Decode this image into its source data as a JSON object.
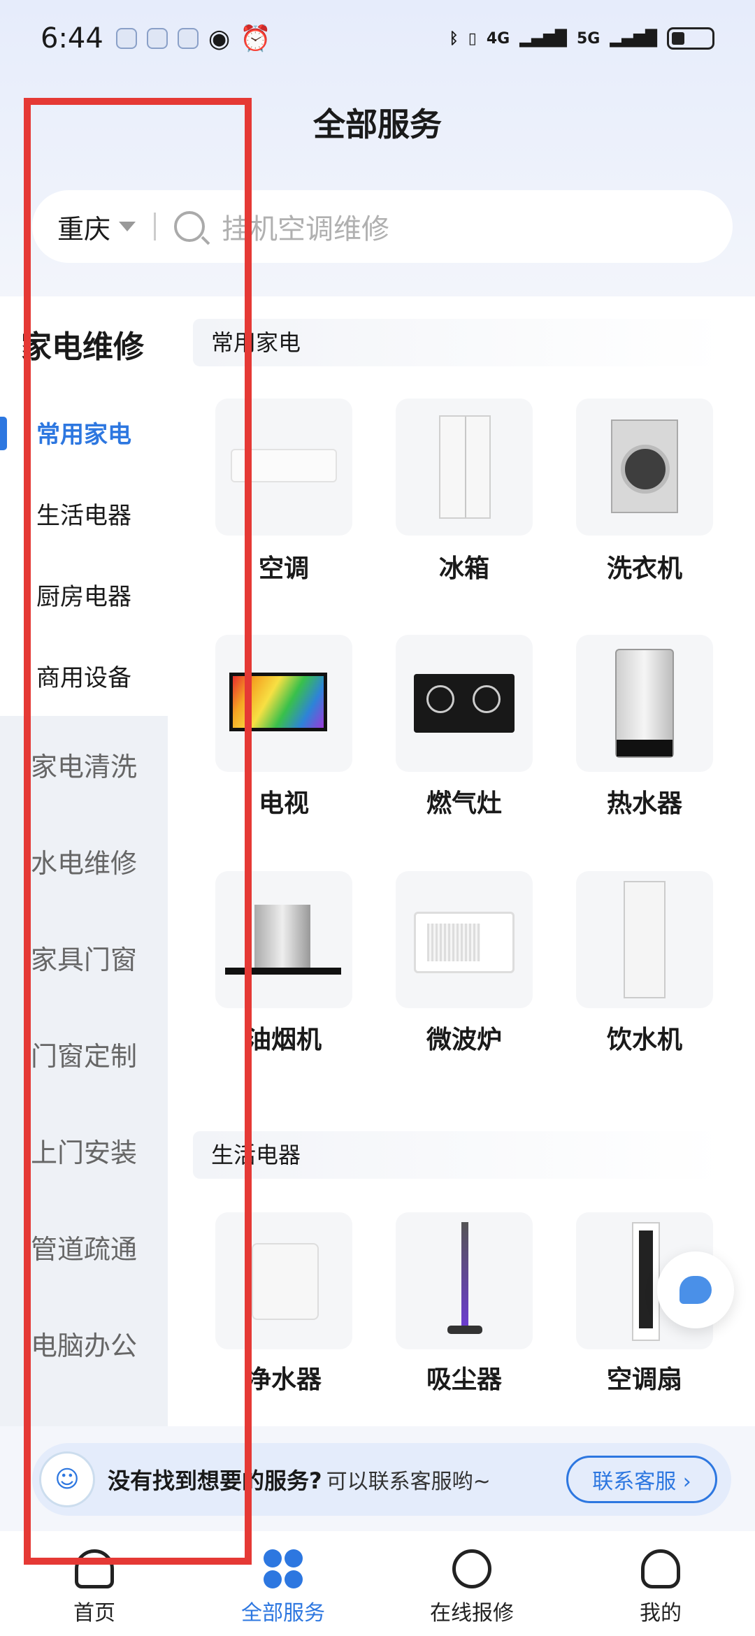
{
  "status": {
    "time": "6:44",
    "net1": "4G",
    "net2": "5G"
  },
  "title": "全部服务",
  "search": {
    "city": "重庆",
    "placeholder": "挂机空调维修"
  },
  "sidebar": {
    "group": "家电维修",
    "items": [
      "常用家电",
      "生活电器",
      "厨房电器",
      "商用设备"
    ],
    "active": "常用家电",
    "others": [
      "家电清洗",
      "水电维修",
      "家具门窗",
      "门窗定制",
      "上门安装",
      "管道疏通",
      "电脑办公"
    ]
  },
  "sections": [
    {
      "title": "常用家电",
      "items": [
        "空调",
        "冰箱",
        "洗衣机",
        "电视",
        "燃气灶",
        "热水器",
        "油烟机",
        "微波炉",
        "饮水机"
      ]
    },
    {
      "title": "生活电器",
      "items": [
        "净水器",
        "吸尘器",
        "空调扇"
      ]
    }
  ],
  "banner": {
    "text_bold": "没有找到想要的服务?",
    "text": "可以联系客服哟~",
    "button": "联系客服 ›"
  },
  "nav": [
    "首页",
    "全部服务",
    "在线报修",
    "我的"
  ],
  "active_nav": "全部服务",
  "colors": {
    "accent": "#2d77e0",
    "highlight": "#e53935"
  }
}
